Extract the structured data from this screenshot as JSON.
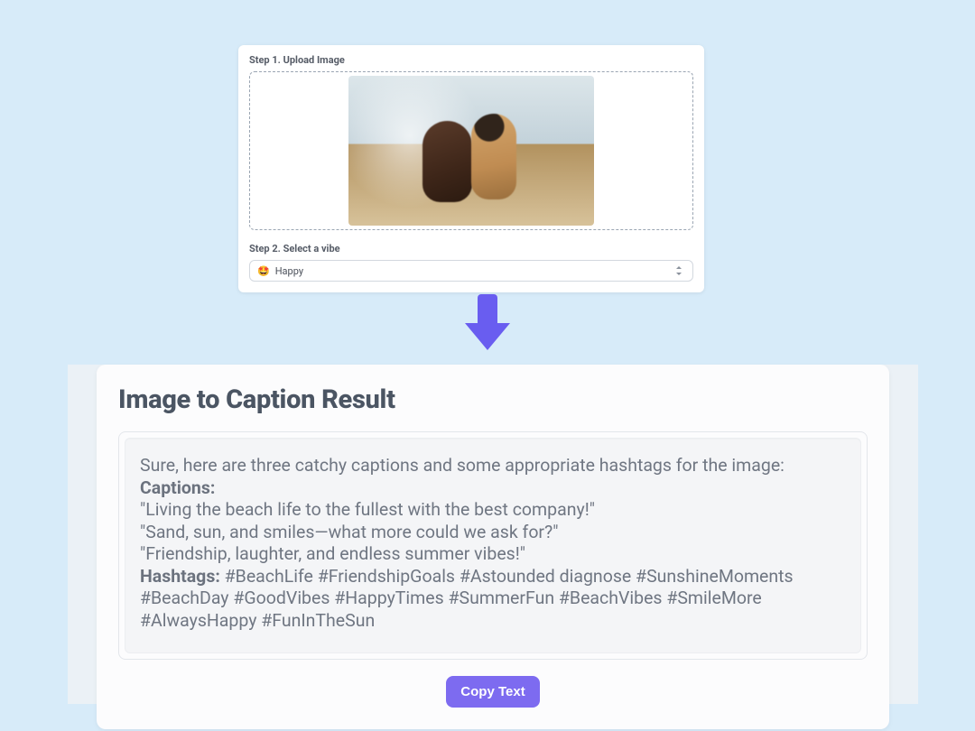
{
  "steps": {
    "step1_label": "Step 1. Upload Image",
    "step2_label": "Step 2. Select a vibe"
  },
  "vibe_select": {
    "emoji": "🤩",
    "value": "Happy"
  },
  "result": {
    "title": "Image to Caption Result",
    "intro": "Sure, here are three catchy captions and some appropriate hashtags for the image:",
    "captions_label": "Captions:",
    "captions": [
      "\"Living the beach life to the fullest with the best company!\"",
      "\"Sand, sun, and smiles—what more could we ask for?\"",
      "\"Friendship, laughter, and endless summer vibes!\""
    ],
    "hashtags_label": "Hashtags:",
    "hashtags_text": "#BeachLife #FriendshipGoals #Astounded diagnose #SunshineMoments #BeachDay #GoodVibes #HappyTimes #SummerFun #BeachVibes #SmileMore #AlwaysHappy #FunInTheSun",
    "copy_button": "Copy Text"
  }
}
